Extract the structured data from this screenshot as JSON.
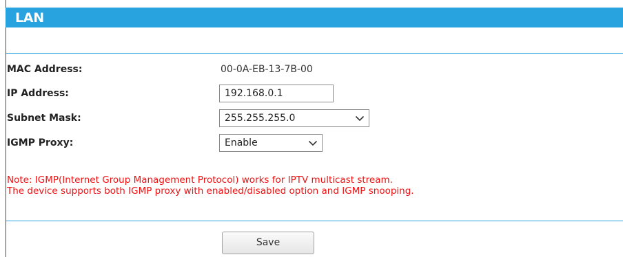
{
  "header": {
    "title": "LAN"
  },
  "fields": {
    "mac_address": {
      "label": "MAC Address:",
      "value": "00-0A-EB-13-7B-00"
    },
    "ip_address": {
      "label": "IP Address:",
      "value": "192.168.0.1"
    },
    "subnet_mask": {
      "label": "Subnet Mask:",
      "selected": "255.255.255.0"
    },
    "igmp_proxy": {
      "label": "IGMP Proxy:",
      "selected": "Enable"
    }
  },
  "note": {
    "line1": "Note: IGMP(Internet Group Management Protocol) works for IPTV multicast stream.",
    "line2": "The device supports both IGMP proxy with enabled/disabled option and IGMP snooping."
  },
  "actions": {
    "save_label": "Save"
  },
  "colors": {
    "header_bg": "#29a3e0",
    "rule": "#29a3e0",
    "note_text": "#ee1111"
  },
  "icons": {
    "select_chevron": "chevron-down-icon"
  }
}
